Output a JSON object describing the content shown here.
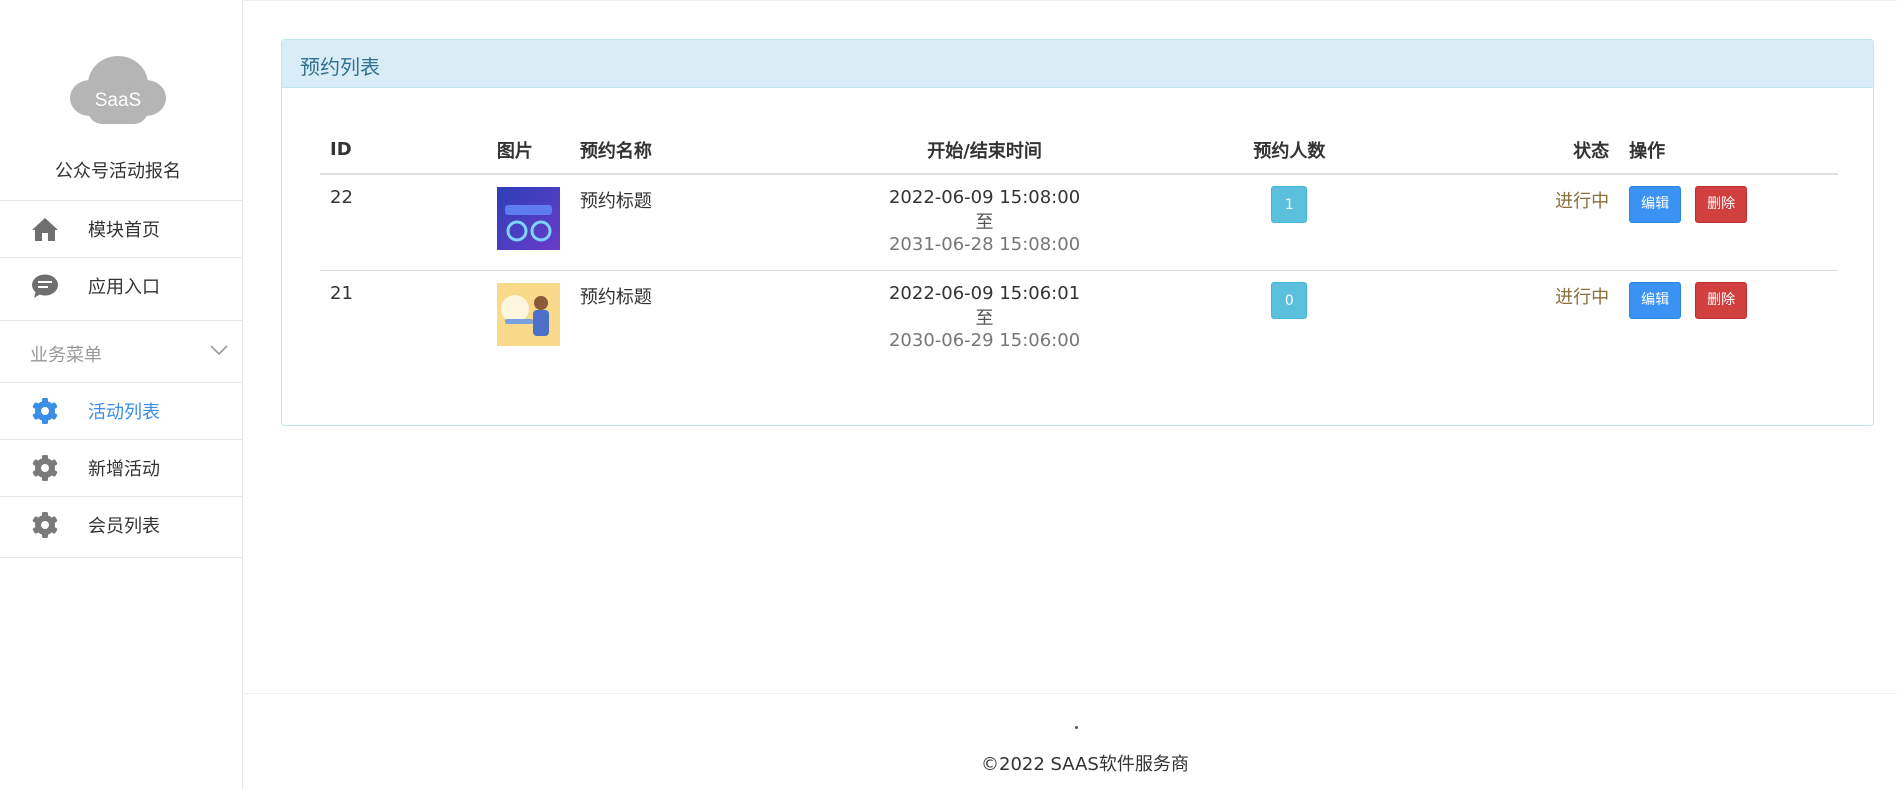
{
  "sidebar": {
    "logo_text": "SaaS",
    "app_name": "公众号活动报名",
    "items": [
      {
        "label": "模块首页",
        "icon": "home-icon"
      },
      {
        "label": "应用入口",
        "icon": "chat-bubble-icon"
      }
    ],
    "group": {
      "label": "业务菜单",
      "icon": "chevron-down-icon"
    },
    "group_items": [
      {
        "label": "活动列表",
        "icon": "gear-icon",
        "active": true
      },
      {
        "label": "新增活动",
        "icon": "gear-icon",
        "active": false
      },
      {
        "label": "会员列表",
        "icon": "gear-icon",
        "active": false
      }
    ]
  },
  "panel": {
    "title": "预约列表",
    "columns": {
      "id": "ID",
      "image": "图片",
      "name": "预约名称",
      "time": "开始/结束时间",
      "count": "预约人数",
      "status": "状态",
      "actions": "操作"
    },
    "rows": [
      {
        "id": "22",
        "name": "预约标题",
        "start": "2022-06-09 15:08:00",
        "separator": "至",
        "end": "2031-06-28 15:08:00",
        "count": "1",
        "status": "进行中",
        "edit_label": "编辑",
        "delete_label": "删除"
      },
      {
        "id": "21",
        "name": "预约标题",
        "start": "2022-06-09 15:06:01",
        "separator": "至",
        "end": "2030-06-29 15:06:00",
        "count": "0",
        "status": "进行中",
        "edit_label": "编辑",
        "delete_label": "删除"
      }
    ]
  },
  "footer": {
    "dot": ".",
    "copyright": "©2022 SAAS软件服务商"
  },
  "colors": {
    "accent": "#3a8ee6",
    "panel_header_bg": "#d9edf7",
    "panel_title": "#31708f",
    "badge_info": "#5bc0de",
    "edit_button": "#3a93f3",
    "delete_button": "#d23f3f",
    "status_text": "#8a6d3b"
  }
}
